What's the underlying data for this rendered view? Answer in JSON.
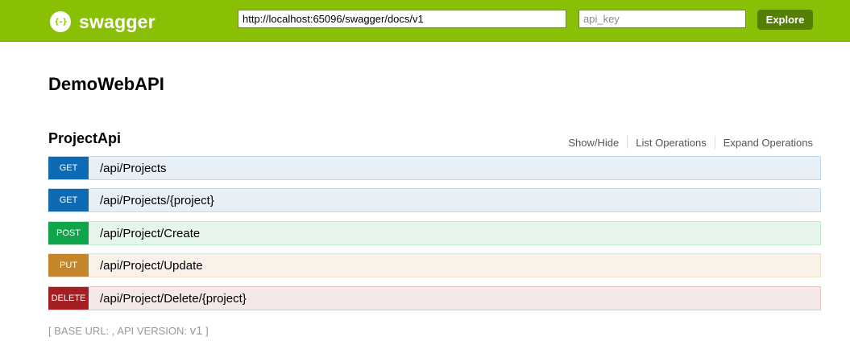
{
  "header": {
    "logo_icon": "{-}",
    "logo_text": "swagger",
    "url_value": "http://localhost:65096/swagger/docs/v1",
    "api_key_placeholder": "api_key",
    "explore_label": "Explore",
    "colors": {
      "bar": "#89bf04",
      "explore": "#547f00"
    }
  },
  "api_title": "DemoWebAPI",
  "resource": {
    "name": "ProjectApi",
    "links": [
      "Show/Hide",
      "List Operations",
      "Expand Operations"
    ]
  },
  "operations": [
    {
      "method": "GET",
      "path": "/api/Projects",
      "color": "#0f6ab4"
    },
    {
      "method": "GET",
      "path": "/api/Projects/{project}",
      "color": "#0f6ab4"
    },
    {
      "method": "POST",
      "path": "/api/Project/Create",
      "color": "#10a54a"
    },
    {
      "method": "PUT",
      "path": "/api/Project/Update",
      "color": "#c5862b"
    },
    {
      "method": "DELETE",
      "path": "/api/Project/Delete/{project}",
      "color": "#a41e22"
    }
  ],
  "footer": {
    "open_bracket": "[",
    "base_url_label": "BASE URL: ",
    "comma": ", ",
    "api_version_label": "API VERSION: ",
    "api_version": "v1",
    "close_bracket": "]"
  }
}
